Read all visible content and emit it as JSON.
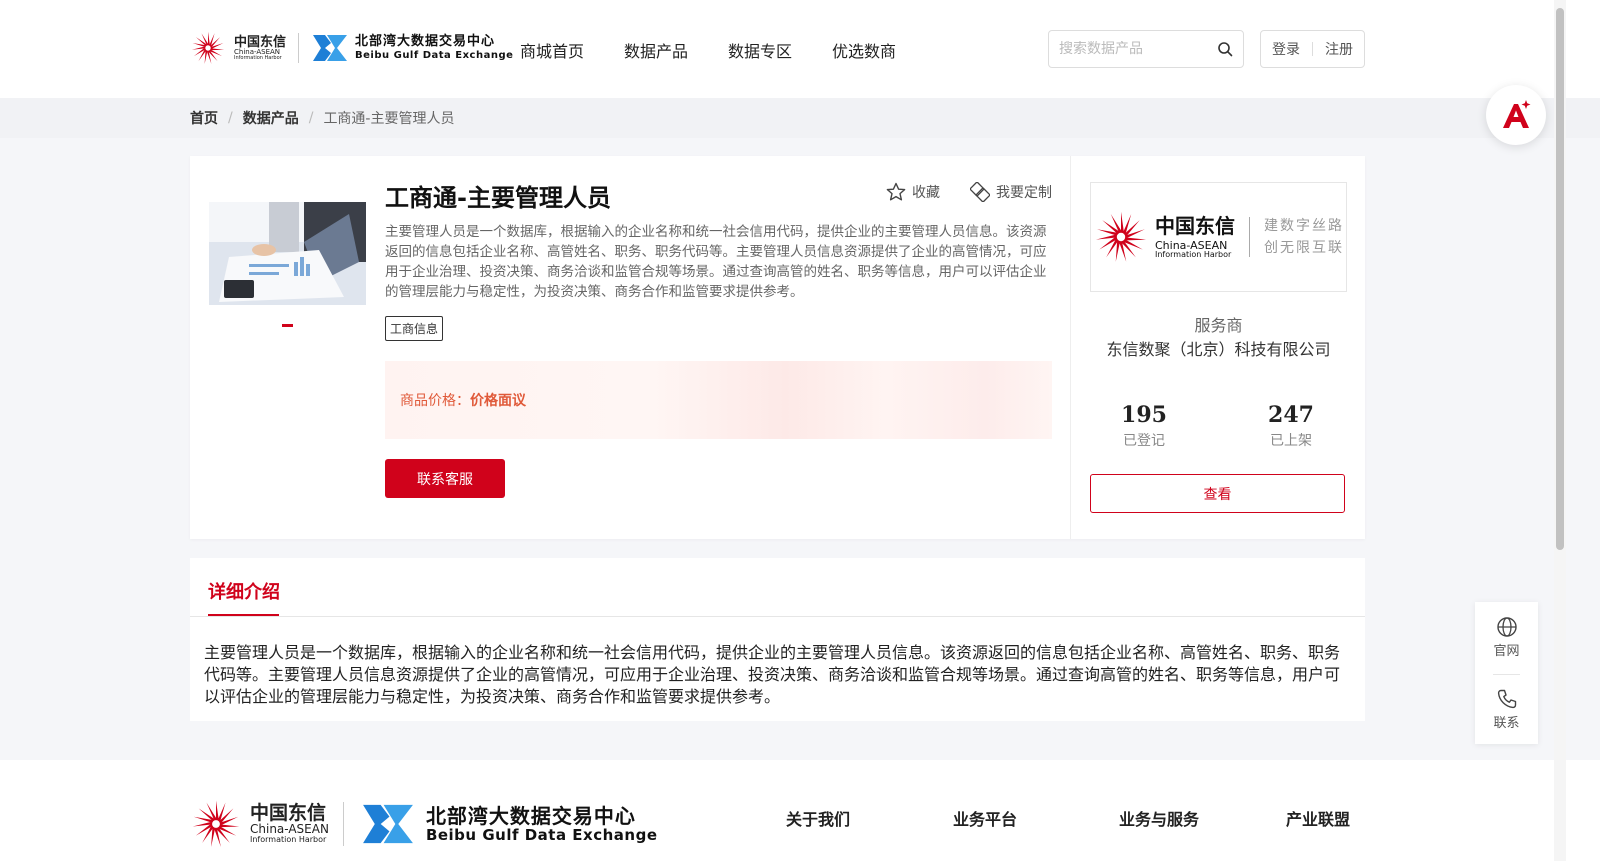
{
  "header": {
    "logo_cn": "中国东信",
    "logo_en1": "China-ASEAN",
    "logo_en2": "Information Harbor",
    "bbg_cn": "北部湾大数据交易中心",
    "bbg_en": "Beibu Gulf Data Exchange",
    "nav": [
      "商城首页",
      "数据产品",
      "数据专区",
      "优选数商"
    ],
    "search_placeholder": "搜索数据产品",
    "login": "登录",
    "register": "注册"
  },
  "breadcrumb": {
    "home": "首页",
    "category": "数据产品",
    "sep": "/",
    "current": "工商通-主要管理人员"
  },
  "product": {
    "title": "工商通-主要管理人员",
    "favorite": "收藏",
    "customize": "我要定制",
    "description": "主要管理人员是一个数据库，根据输入的企业名称和统一社会信用代码，提供企业的主要管理人员信息。该资源返回的信息包括企业名称、高管姓名、职务、职务代码等。主要管理人员信息资源提供了企业的高管情况，可应用于企业治理、投资决策、商务洽谈和监管合规等场景。通过查询高管的姓名、职务等信息，用户可以评估企业的管理层能力与稳定性，为投资决策、商务合作和监管要求提供参考。",
    "tag": "工商信息",
    "price_label": "商品价格：",
    "price_value": "价格面议",
    "contact_button": "联系客服"
  },
  "provider": {
    "logo_cn": "中国东信",
    "logo_en1": "China-ASEAN",
    "logo_en2": "Information Harbor",
    "slogan1": "建数字丝路",
    "slogan2": "创无限互联",
    "role": "服务商",
    "name": "东信数聚（北京）科技有限公司",
    "stats": [
      {
        "value": "195",
        "label": "已登记"
      },
      {
        "value": "247",
        "label": "已上架"
      }
    ],
    "view_button": "查看"
  },
  "detail": {
    "tab": "详细介绍",
    "text": "主要管理人员是一个数据库，根据输入的企业名称和统一社会信用代码，提供企业的主要管理人员信息。该资源返回的信息包括企业名称、高管姓名、职务、职务代码等。主要管理人员信息资源提供了企业的高管情况，可应用于企业治理、投资决策、商务洽谈和监管合规等场景。通过查询高管的姓名、职务等信息，用户可以评估企业的管理层能力与稳定性，为投资决策、商务合作和监管要求提供参考。"
  },
  "footer": {
    "logo_cn": "中国东信",
    "logo_en1": "China-ASEAN",
    "logo_en2": "Information Harbor",
    "bbg_cn": "北部湾大数据交易中心",
    "bbg_en": "Beibu Gulf Data Exchange",
    "links": [
      "关于我们",
      "业务平台",
      "业务与服务",
      "产业联盟"
    ]
  },
  "side": {
    "website": "官网",
    "contact": "联系"
  },
  "colors": {
    "brand_red": "#d0021b",
    "price_orange": "#e05a3a",
    "bbg_blue": "#1e7fd6"
  },
  "icons": {
    "search": "search-icon",
    "favorite": "star-icon",
    "customize": "customize-icon",
    "website": "globe-icon",
    "contact": "phone-icon",
    "ai": "ai-assistant-icon"
  }
}
